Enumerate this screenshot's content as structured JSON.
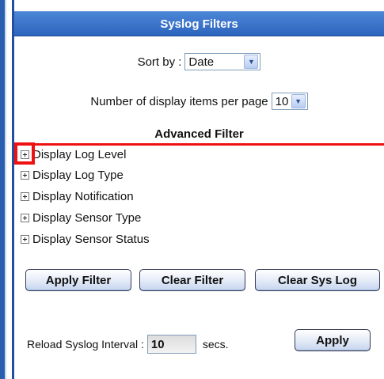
{
  "panel": {
    "title": "Syslog Filters"
  },
  "sort": {
    "label": "Sort by :",
    "value": "Date"
  },
  "per_page": {
    "label": "Number of display items per page",
    "value": "10"
  },
  "advanced": {
    "title": "Advanced Filter",
    "items": [
      {
        "label": "Display Log Level"
      },
      {
        "label": "Display Log Type"
      },
      {
        "label": "Display Notification"
      },
      {
        "label": "Display Sensor Type"
      },
      {
        "label": "Display Sensor Status"
      }
    ]
  },
  "buttons": {
    "apply_filter": "Apply Filter",
    "clear_filter": "Clear Filter",
    "clear_sys_log": "Clear Sys Log"
  },
  "reload": {
    "label": "Reload Syslog Interval :",
    "value": "10",
    "unit": "secs.",
    "apply": "Apply"
  },
  "colors": {
    "header": "#2d64be",
    "highlight": "#ee1111"
  }
}
